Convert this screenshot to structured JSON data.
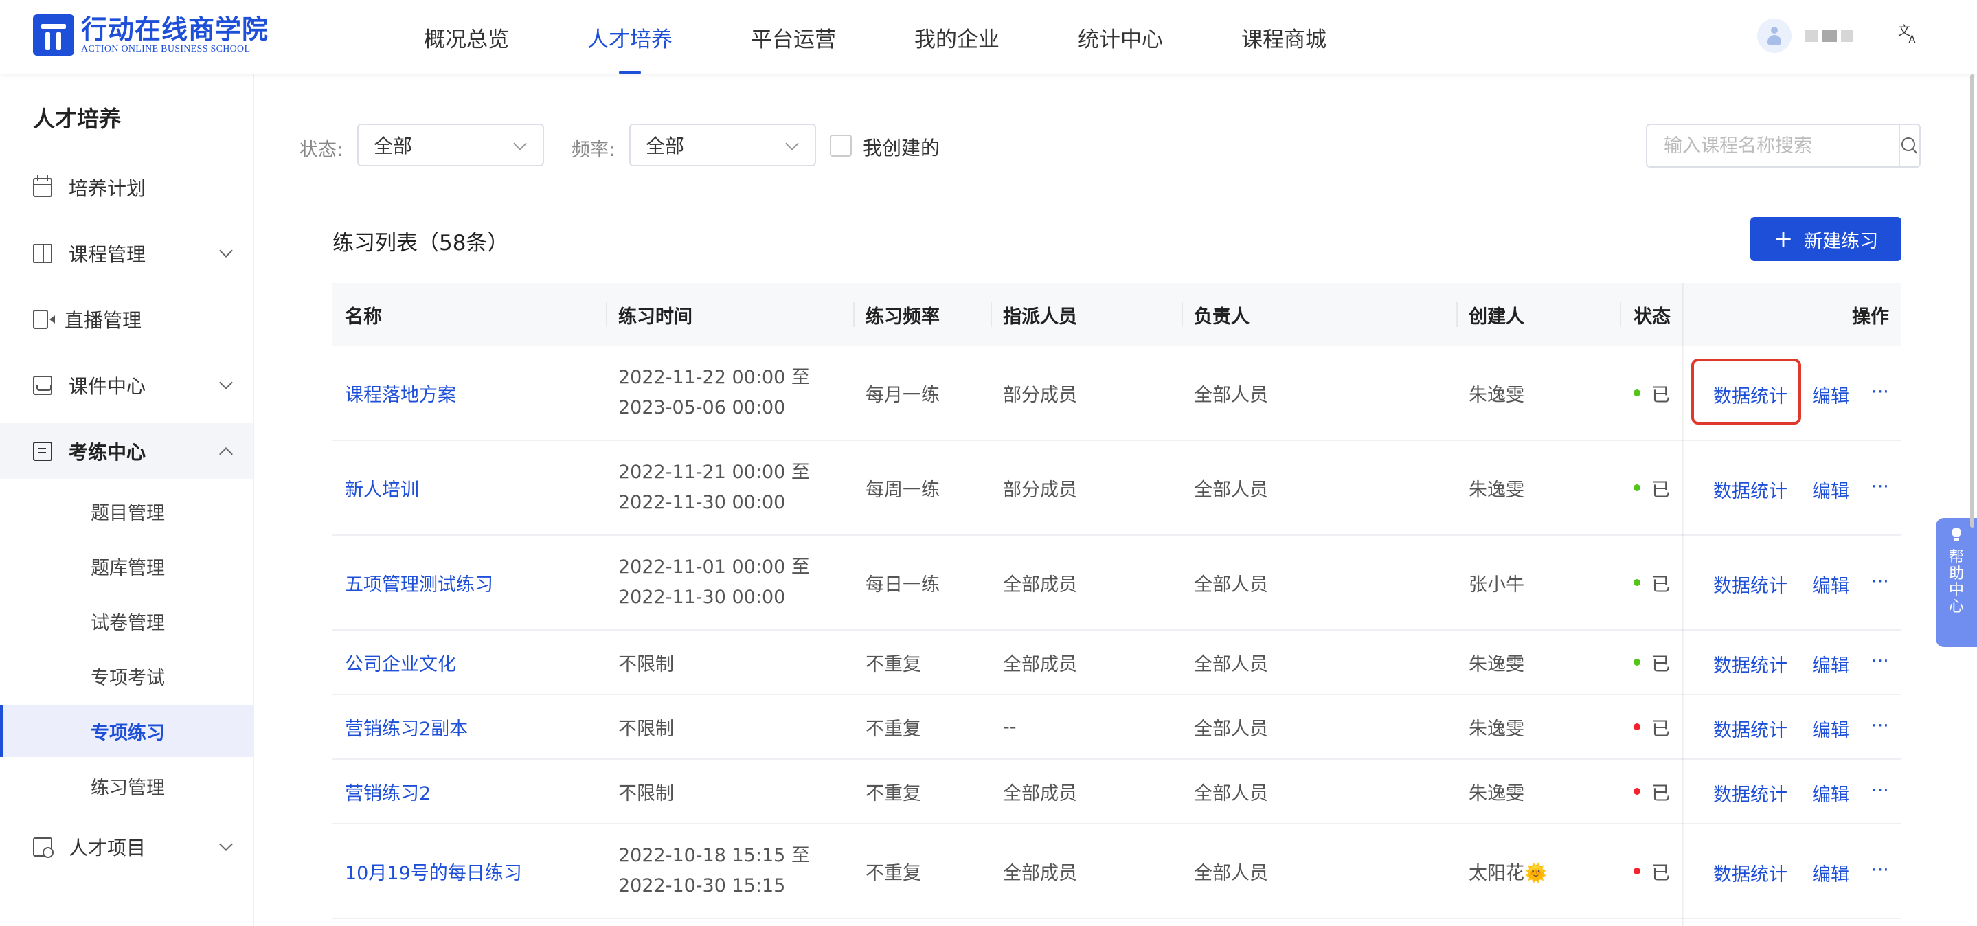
{
  "brand": {
    "name_cn": "行动在线商学院",
    "name_en": "ACTION ONLINE BUSINESS SCHOOL",
    "color": "#1e4fd8"
  },
  "topnav": {
    "items": [
      {
        "label": "概况总览"
      },
      {
        "label": "人才培养"
      },
      {
        "label": "平台运营"
      },
      {
        "label": "我的企业"
      },
      {
        "label": "统计中心"
      },
      {
        "label": "课程商城"
      }
    ],
    "active": "人才培养",
    "lang_icon": "文A"
  },
  "sidebar": {
    "title": "人才培养",
    "items": [
      {
        "label": "培养计划",
        "icon": "calendar-icon"
      },
      {
        "label": "课程管理",
        "icon": "book-icon"
      },
      {
        "label": "直播管理",
        "icon": "video-icon"
      },
      {
        "label": "课件中心",
        "icon": "inbox-icon"
      },
      {
        "label": "考练中心",
        "icon": "exam-icon"
      },
      {
        "label": "人才项目",
        "icon": "talent-icon"
      }
    ],
    "sub_items": [
      {
        "label": "题目管理"
      },
      {
        "label": "题库管理"
      },
      {
        "label": "试卷管理"
      },
      {
        "label": "专项考试"
      },
      {
        "label": "专项练习"
      },
      {
        "label": "练习管理"
      }
    ],
    "active_sub": "专项练习"
  },
  "filters": {
    "status_label": "状态:",
    "status_value": "全部",
    "frequency_label": "频率:",
    "frequency_value": "全部",
    "mine_label": "我创建的",
    "search_placeholder": "输入课程名称搜索"
  },
  "list": {
    "title": "练习列表（58条）",
    "new_button": "新建练习",
    "new_button_icon": "plus-icon"
  },
  "table": {
    "headers": [
      "名称",
      "练习时间",
      "练习频率",
      "指派人员",
      "负责人",
      "创建人",
      "状态",
      "操作"
    ],
    "rows": [
      {
        "name": "课程落地方案",
        "time1": "2022-11-22 00:00 至",
        "time2": "2023-05-06 00:00",
        "frequency": "每月一练",
        "assignee": "部分成员",
        "owner": "全部人员",
        "creator": "朱逸雯",
        "status": "已上架",
        "status_color": "#52c41a",
        "op_stats": "数据统计",
        "op_edit": "编辑",
        "op_more": "···"
      },
      {
        "name": "新人培训",
        "time1": "2022-11-21 00:00 至",
        "time2": "2022-11-30 00:00",
        "frequency": "每周一练",
        "assignee": "部分成员",
        "owner": "全部人员",
        "creator": "朱逸雯",
        "status": "已上架",
        "status_color": "#52c41a",
        "op_stats": "数据统计",
        "op_edit": "编辑",
        "op_more": "···"
      },
      {
        "name": "五项管理测试练习",
        "time1": "2022-11-01 00:00 至",
        "time2": "2022-11-30 00:00",
        "frequency": "每日一练",
        "assignee": "全部成员",
        "owner": "全部人员",
        "creator": "张小牛",
        "status": "已上架",
        "status_color": "#52c41a",
        "op_stats": "数据统计",
        "op_edit": "编辑",
        "op_more": "···"
      },
      {
        "name": "公司企业文化",
        "time1": "不限制",
        "time2": "",
        "frequency": "不重复",
        "assignee": "全部成员",
        "owner": "全部人员",
        "creator": "朱逸雯",
        "status": "已上架",
        "status_color": "#52c41a",
        "op_stats": "数据统计",
        "op_edit": "编辑",
        "op_more": "···"
      },
      {
        "name": "营销练习2副本",
        "time1": "不限制",
        "time2": "",
        "frequency": "不重复",
        "assignee": "--",
        "owner": "全部人员",
        "creator": "朱逸雯",
        "status": "已下架",
        "status_color": "#f5222d",
        "op_stats": "数据统计",
        "op_edit": "编辑",
        "op_more": "···"
      },
      {
        "name": "营销练习2",
        "time1": "不限制",
        "time2": "",
        "frequency": "不重复",
        "assignee": "全部成员",
        "owner": "全部人员",
        "creator": "朱逸雯",
        "status": "已下架",
        "status_color": "#f5222d",
        "op_stats": "数据统计",
        "op_edit": "编辑",
        "op_more": "···"
      },
      {
        "name": "10月19号的每日练习",
        "time1": "2022-10-18 15:15 至",
        "time2": "2022-10-30 15:15",
        "frequency": "不重复",
        "assignee": "全部成员",
        "owner": "全部人员",
        "creator": "太阳花🌞",
        "status": "已下架",
        "status_color": "#f5222d",
        "op_stats": "数据统计",
        "op_edit": "编辑",
        "op_more": "···"
      }
    ]
  },
  "help": {
    "label": "帮助中心",
    "icon": "bulb-icon"
  }
}
